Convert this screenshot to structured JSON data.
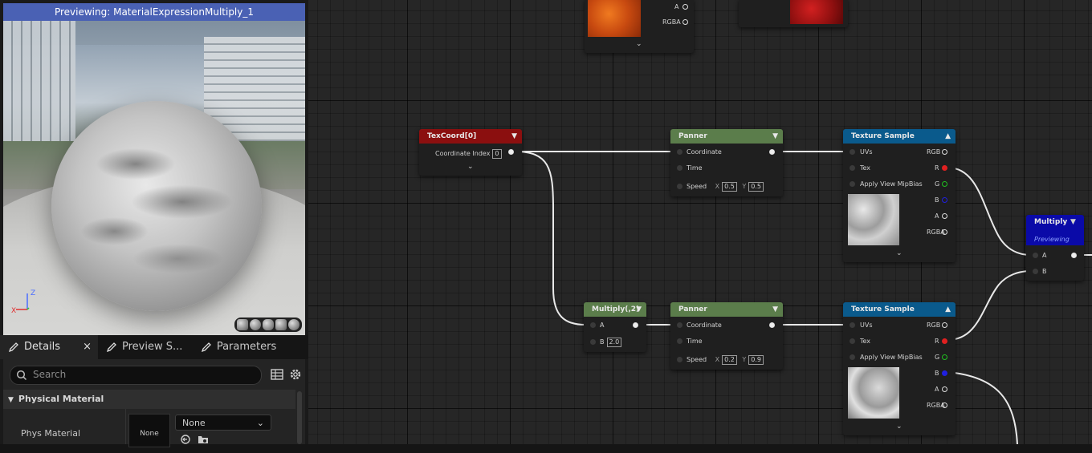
{
  "viewport": {
    "title": "Previewing: MaterialExpressionMultiply_1",
    "axis_z": "Z",
    "axis_x": "X"
  },
  "tabs": [
    {
      "label": "Details",
      "close": "×"
    },
    {
      "label": "Preview S..."
    },
    {
      "label": "Parameters"
    }
  ],
  "details": {
    "search_placeholder": "Search",
    "category": "Physical Material",
    "property_label": "Phys Material",
    "thumbnail_text": "None",
    "dropdown_value": "None"
  },
  "graph": {
    "top_nodes": {
      "pin_a": "A",
      "pin_rgba": "RGBA"
    },
    "texcoord": {
      "title": "TexCoord[0]",
      "coord_label": "Coordinate Index",
      "coord_value": "0"
    },
    "panner_1": {
      "title": "Panner",
      "coordinate": "Coordinate",
      "time": "Time",
      "speed": "Speed",
      "x_label": "X",
      "x_value": "0.5",
      "y_label": "Y",
      "y_value": "0.5"
    },
    "texture_1": {
      "title": "Texture Sample",
      "uvs": "UVs",
      "tex": "Tex",
      "mip": "Apply View MipBias",
      "out_rgb": "RGB",
      "out_r": "R",
      "out_g": "G",
      "out_b": "B",
      "out_a": "A",
      "out_rgba": "RGBA"
    },
    "multiply_main": {
      "title": "Multiply",
      "status": "Previewing",
      "pin_a": "A",
      "pin_b": "B"
    },
    "multiply_2": {
      "title": "Multiply(,2)",
      "pin_a": "A",
      "pin_b": "B",
      "b_value": "2.0"
    },
    "panner_2": {
      "title": "Panner",
      "coordinate": "Coordinate",
      "time": "Time",
      "speed": "Speed",
      "x_label": "X",
      "x_value": "0.2",
      "y_label": "Y",
      "y_value": "0.9"
    },
    "texture_2": {
      "title": "Texture Sample",
      "uvs": "UVs",
      "tex": "Tex",
      "mip": "Apply View MipBias",
      "out_rgb": "RGB",
      "out_r": "R",
      "out_g": "G",
      "out_b": "B",
      "out_a": "A",
      "out_rgba": "RGBA"
    }
  },
  "colors": {
    "texcoord": "#8b0f0f",
    "panner": "#5b7d4b",
    "texture": "#0a5a8c",
    "multiply_main": "#0a0aa8",
    "multiply_2": "#5b7d4b",
    "title_bar": "#4a61b4"
  }
}
